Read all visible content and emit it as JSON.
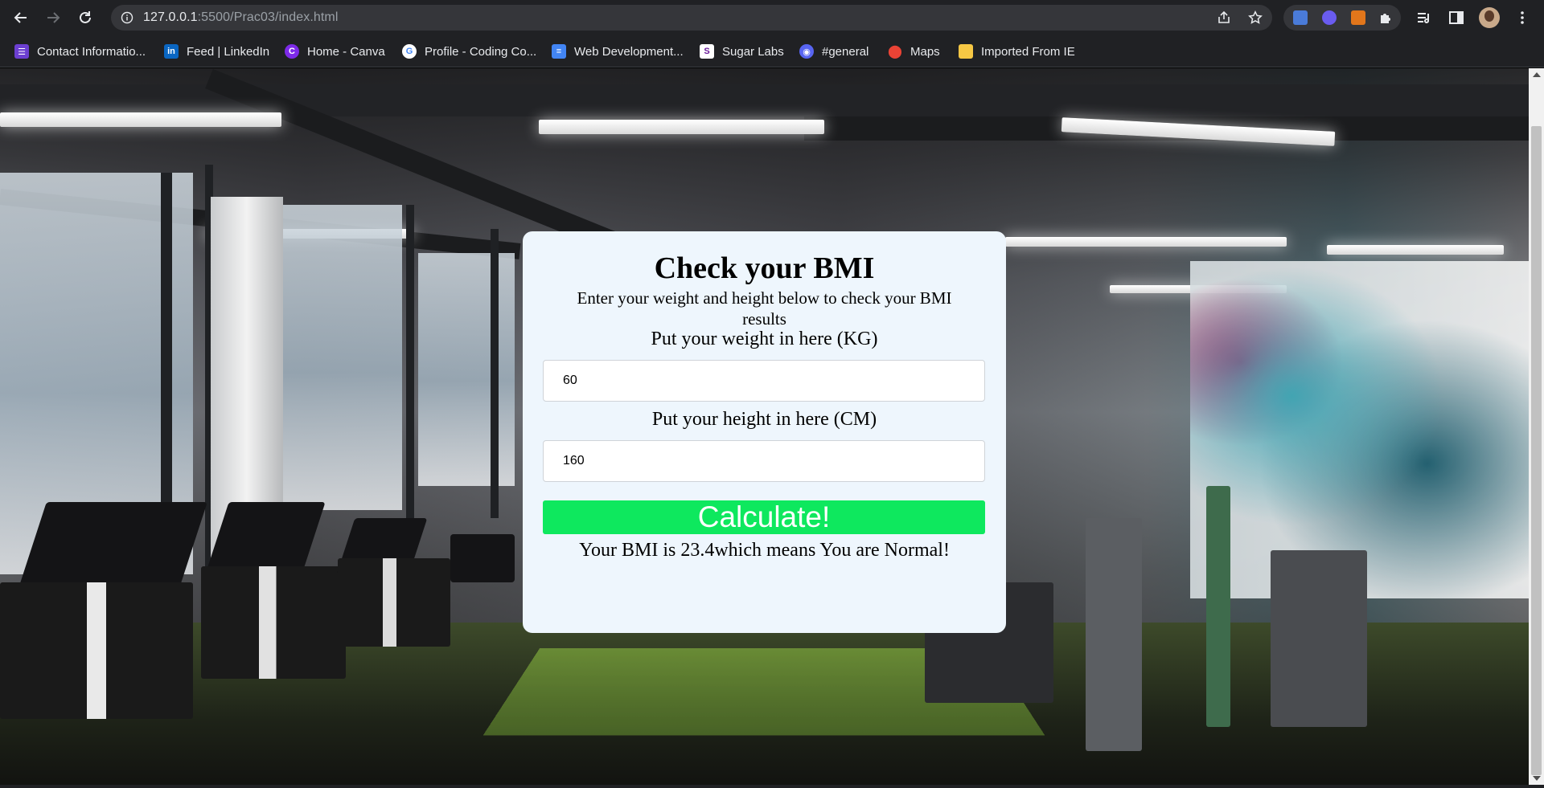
{
  "browser": {
    "url_host": "127.0.0.1",
    "url_rest": ":5500/Prac03/index.html",
    "bookmarks": [
      {
        "label": "Contact Informatio...",
        "icon": "list-icon",
        "color": "#6c3fd1"
      },
      {
        "label": "Feed | LinkedIn",
        "icon": "linkedin-icon",
        "color": "#0a66c2"
      },
      {
        "label": "Home - Canva",
        "icon": "canva-icon",
        "color": "#7d2ae8"
      },
      {
        "label": "Profile - Coding Co...",
        "icon": "google-icon",
        "color": "#ffffff"
      },
      {
        "label": "Web Development...",
        "icon": "docs-icon",
        "color": "#4285f4"
      },
      {
        "label": "Sugar Labs",
        "icon": "sugarlabs-icon",
        "color": "#ffffff"
      },
      {
        "label": "#general",
        "icon": "discord-icon",
        "color": "#5865f2"
      },
      {
        "label": "Maps",
        "icon": "maps-icon",
        "color": "#34a853"
      },
      {
        "label": "Imported From IE",
        "icon": "folder-icon",
        "color": "#f6c744"
      }
    ]
  },
  "page": {
    "title": "Check your BMI",
    "subtitle": "Enter your weight and height below to check your BMI results",
    "weight_label": "Put your weight in here (KG)",
    "weight_value": "60",
    "height_label": "Put your height in here (CM)",
    "height_value": "160",
    "button_label": "Calculate!",
    "result": "Your BMI is 23.4which means You are Normal!",
    "accent_color": "#0ee85e",
    "card_color": "#eef6fd"
  }
}
